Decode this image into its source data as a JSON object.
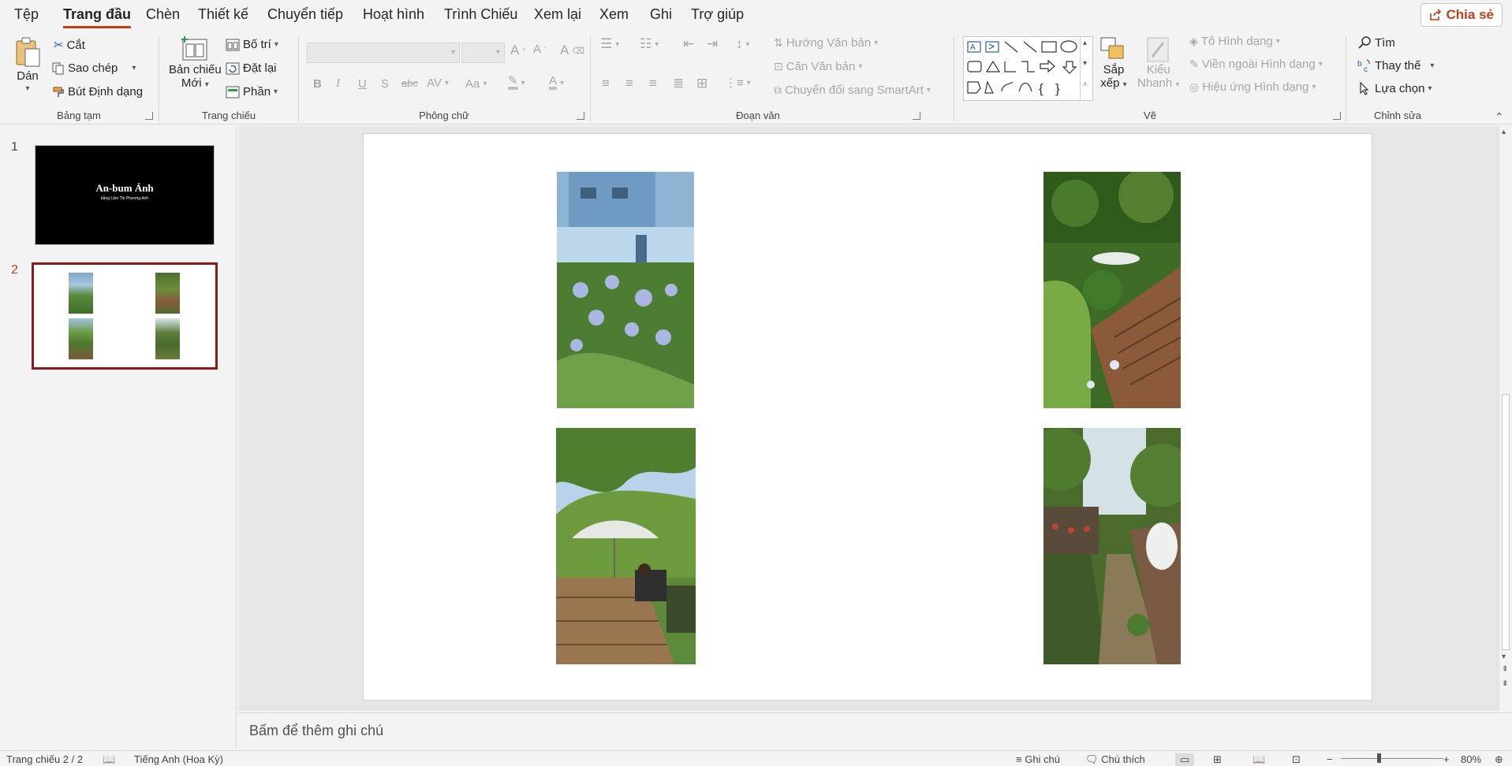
{
  "menu": {
    "tabs": [
      "Tệp",
      "Trang đầu",
      "Chèn",
      "Thiết kế",
      "Chuyển tiếp",
      "Hoạt hình",
      "Trình Chiếu",
      "Xem lại",
      "Xem",
      "Ghi",
      "Trợ giúp"
    ],
    "active_tab": "Trang đầu",
    "share_label": "Chia sẻ"
  },
  "ribbon": {
    "clipboard": {
      "paste": "Dán",
      "cut": "Cắt",
      "copy": "Sao chép",
      "format_painter": "Bút Định dạng",
      "label": "Bảng tạm"
    },
    "slides": {
      "new_slide_1": "Bản chiếu",
      "new_slide_2": "Mới",
      "layout": "Bố trí",
      "reset": "Đặt lại",
      "section": "Phần",
      "label": "Trang chiếu"
    },
    "font": {
      "label": "Phông chữ"
    },
    "paragraph": {
      "text_direction": "Hướng Văn bản",
      "align_text": "Căn Văn bản",
      "smartart": "Chuyển đổi sang SmartArt",
      "label": "Đoạn văn"
    },
    "drawing": {
      "arrange_1": "Sắp",
      "arrange_2": "xếp",
      "quick_styles_1": "Kiểu",
      "quick_styles_2": "Nhanh",
      "shape_fill": "Tô Hình dạng",
      "shape_outline": "Viền ngoài Hình dạng",
      "shape_effects": "Hiệu ứng Hình dạng",
      "label": "Vẽ"
    },
    "editing": {
      "find": "Tìm",
      "replace": "Thay thế",
      "select": "Lựa chọn",
      "label": "Chỉnh sửa"
    }
  },
  "thumbnails": {
    "slide1_num": "1",
    "slide1_title": "An-bum Ảnh",
    "slide1_subtitle": "bằng Lâm Thị Phương Anh",
    "slide2_num": "2"
  },
  "notes_placeholder": "Bấm để thêm ghi chú",
  "status": {
    "slide_count": "Trang chiếu 2 / 2",
    "language": "Tiếng Anh (Hoa Kỳ)",
    "notes": "Ghi chú",
    "comments": "Chú thích",
    "zoom": "80%"
  }
}
